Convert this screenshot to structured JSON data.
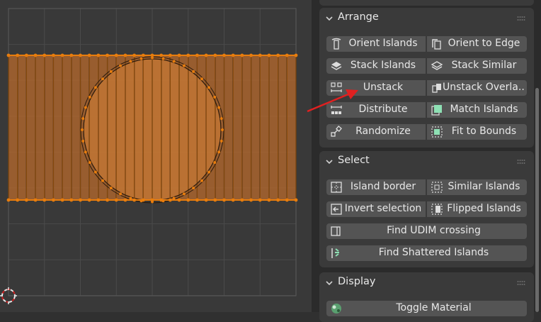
{
  "arrange": {
    "title": "Arrange",
    "rows": [
      {
        "left": {
          "label": "Orient Islands",
          "icon": "orient-islands-icon"
        },
        "right": {
          "label": "Orient to Edge",
          "icon": "orient-edge-icon"
        }
      },
      {
        "left": {
          "label": "Stack Islands",
          "icon": "stack-islands-icon"
        },
        "right": {
          "label": "Stack Similar",
          "icon": "stack-similar-icon"
        }
      },
      {
        "left": {
          "label": "Unstack",
          "icon": "unstack-icon"
        },
        "right": {
          "label": "Unstack Overla...",
          "icon": "unstack-overlapped-icon"
        }
      },
      {
        "left": {
          "label": "Distribute",
          "icon": "distribute-icon"
        },
        "right": {
          "label": "Match Islands",
          "icon": "match-islands-icon"
        }
      },
      {
        "left": {
          "label": "Randomize",
          "icon": "randomize-icon"
        },
        "right": {
          "label": "Fit to Bounds",
          "icon": "fit-bounds-icon"
        }
      }
    ]
  },
  "select": {
    "title": "Select",
    "rows": [
      {
        "left": {
          "label": "Island border",
          "icon": "island-border-icon"
        },
        "right": {
          "label": "Similar Islands",
          "icon": "similar-islands-icon"
        }
      },
      {
        "left": {
          "label": "Invert selection",
          "icon": "invert-selection-icon"
        },
        "right": {
          "label": "Flipped Islands",
          "icon": "flipped-islands-icon"
        }
      }
    ],
    "full": [
      {
        "label": "Find UDIM crossing",
        "icon": "udim-crossing-icon"
      },
      {
        "label": "Find Shattered Islands",
        "icon": "shattered-islands-icon"
      }
    ]
  },
  "display": {
    "title": "Display",
    "full": [
      {
        "label": "Toggle Material",
        "icon": "material-icon"
      }
    ]
  },
  "colors": {
    "accent": "#e87d0d",
    "face_fill": "#b86a2c",
    "annotation_arrow": "#e02020"
  }
}
